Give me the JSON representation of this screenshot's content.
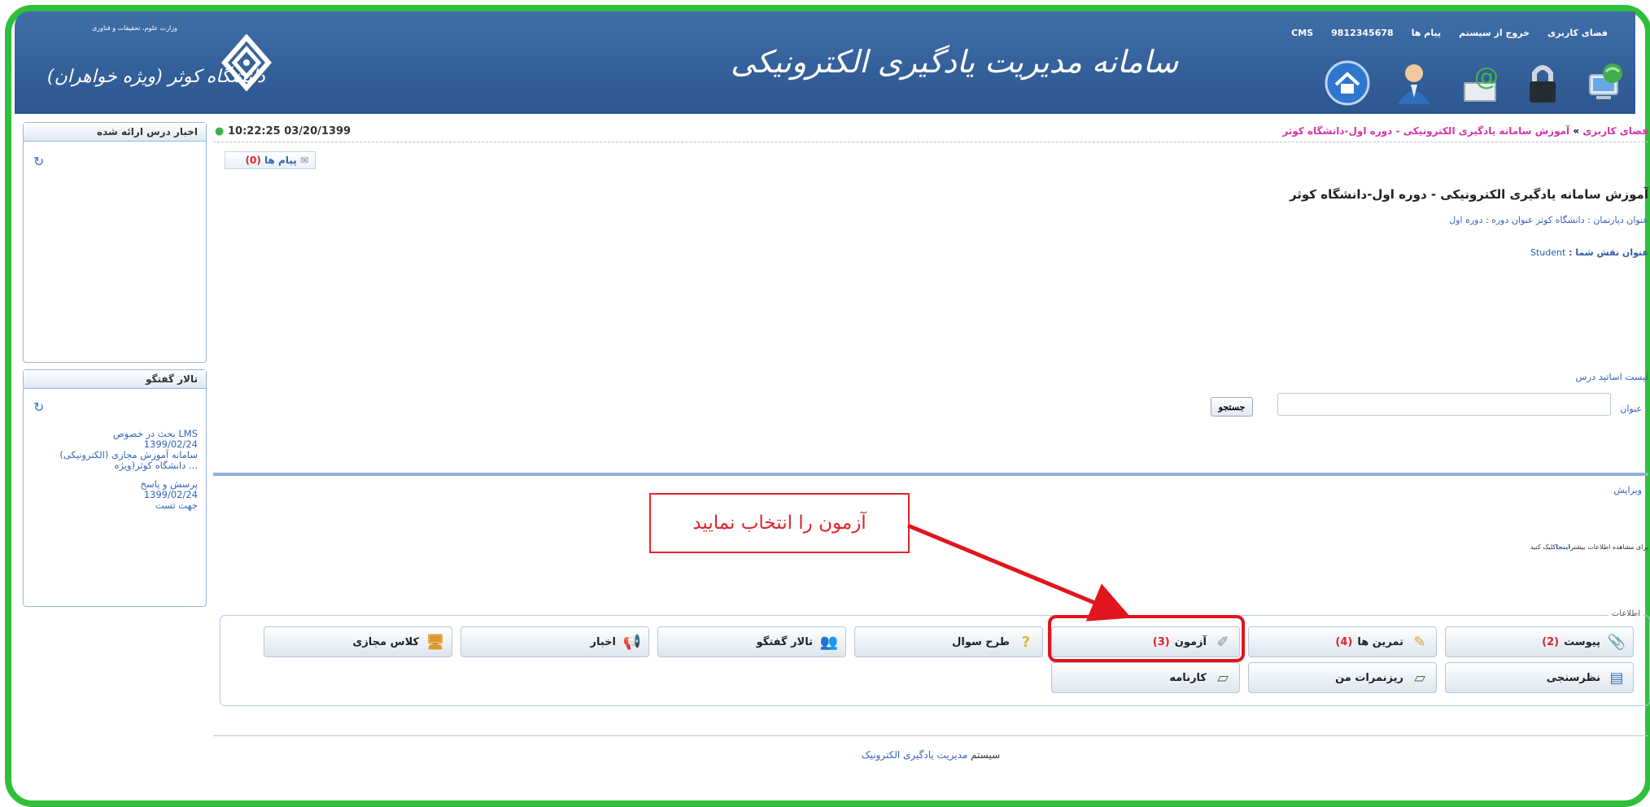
{
  "header": {
    "toplinks": [
      "فضای کاربری",
      "خروج از سیستم",
      "پیام ها",
      "9812345678",
      "CMS"
    ],
    "site_title": "سامانه مدیریت یادگیری الکترونیکی",
    "ministry": "وزارت علوم، تحقیقات و فناوری",
    "university": "دانشگاه کوثر (ویژه خواهران)",
    "icons": [
      "network-computer-icon",
      "lock-icon",
      "email-icon",
      "user-icon",
      "home-icon"
    ]
  },
  "left": {
    "news_title": "اخبار درس ارائه شده",
    "forum_title": "تالار گفتگو",
    "forum_items": [
      {
        "lines": [
          "بحث در خصوص LMS",
          "1399/02/24",
          "سامانه آموزش مجازی (الکترونیکی)",
          "دانشگاه کوثر(ویژه ..."
        ]
      },
      {
        "lines": [
          "پرسش و پاسخ",
          "1399/02/24",
          "جهت تست"
        ]
      }
    ]
  },
  "main": {
    "clock": "10:22:25 03/20/1399",
    "breadcrumb_home": "فضای کاربری",
    "breadcrumb_sep": " » ",
    "breadcrumb_course": "آموزش سامانه یادگیری الکترونیکی - دوره اول-دانشگاه کوثر",
    "messages_label": "پیام ها",
    "messages_count": "(0)",
    "course_title": "آموزش سامانه یادگیری الکترونیکی - دوره اول-دانشگاه کوثر",
    "meta": "عنوان دپارتمان : دانشگاه کوثر    عنوان دوره : دوره اول",
    "role_label": "عنوان نقش شما : ",
    "role_value": "Student",
    "teachers_label": "لیست اساتید درس",
    "search_label": "عنوان",
    "search_button": "جستجو",
    "edit_link": "ویرایش",
    "more_info_prefix": "برای مشاهده اطلاعات بیشتر",
    "more_info_link": "اینجا",
    "more_info_suffix": "کلیک کنید",
    "info_legend": "اطلاعات",
    "footer_prefix": "سیستم",
    "footer_rest": " مدیریت یادگیری الکترونیک"
  },
  "nav": {
    "post": {
      "label": "پیوست",
      "count": "(2)"
    },
    "exercises": {
      "label": "تمرین ها",
      "count": "(4)"
    },
    "exam": {
      "label": "آزمون",
      "count": "(3)"
    },
    "question_design": {
      "label": "طرح سوال"
    },
    "forum": {
      "label": "تالار گفتگو"
    },
    "news": {
      "label": "اخبار"
    },
    "virtual_class": {
      "label": "کلاس مجازی"
    },
    "survey": {
      "label": "نظرسنجی"
    },
    "my_grades": {
      "label": "ریزنمرات من"
    },
    "report_card": {
      "label": "کارنامه"
    }
  },
  "annotation": {
    "callout_text": "آزمون را انتخاب نمایید",
    "accent": "#e0252b"
  },
  "colors": {
    "frame": "#2fbf3a",
    "header": "#2c5690",
    "link": "#3564b8",
    "count": "#e0222a"
  }
}
